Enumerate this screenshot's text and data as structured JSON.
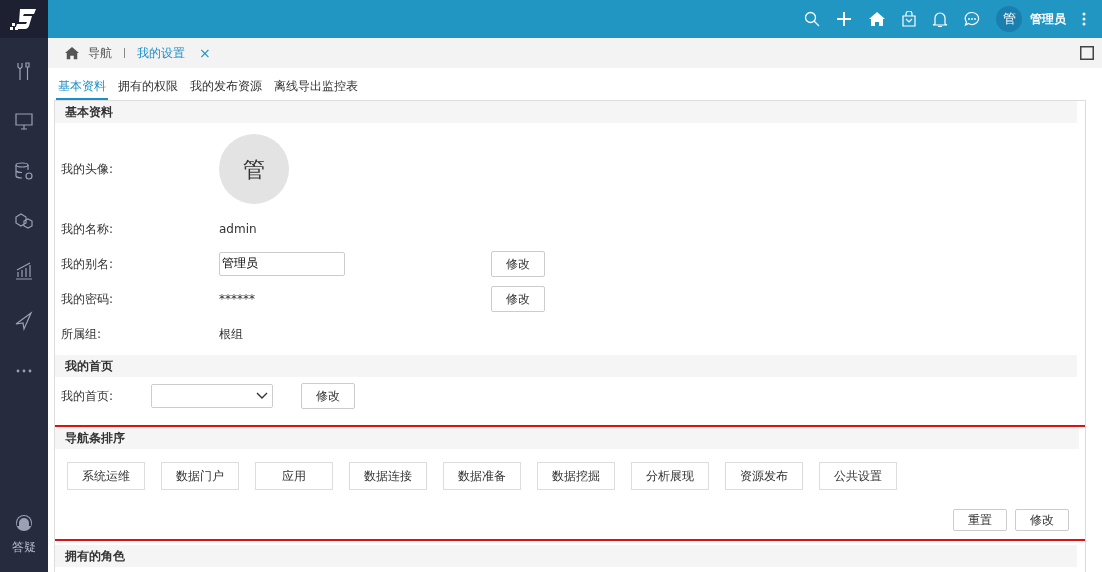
{
  "topbar": {
    "avatar_text": "管",
    "user_name": "管理员"
  },
  "sidebar": {
    "help_label": "答疑"
  },
  "breadcrumb": {
    "home": "导航",
    "current": "我的设置",
    "close": "×"
  },
  "tabs": [
    {
      "label": "基本资料",
      "selected": true
    },
    {
      "label": "拥有的权限",
      "selected": false
    },
    {
      "label": "我的发布资源",
      "selected": false
    },
    {
      "label": "离线导出监控表",
      "selected": false
    }
  ],
  "basic": {
    "title": "基本资料",
    "avatar_label": "我的头像:",
    "avatar_text": "管",
    "rows": [
      {
        "kind": "text",
        "label": "我的名称:",
        "value": "admin"
      },
      {
        "kind": "input",
        "label": "我的别名:",
        "value": "管理员",
        "button": "修改"
      },
      {
        "kind": "text",
        "label": "我的密码:",
        "value": "******",
        "button": "修改"
      },
      {
        "kind": "text",
        "label": "所属组:",
        "value": "根组"
      }
    ]
  },
  "homepage": {
    "title": "我的首页",
    "label": "我的首页:",
    "button": "修改"
  },
  "nav_order": {
    "title": "导航条排序",
    "highlighted": true,
    "items": [
      "系统运维",
      "数据门户",
      "应用",
      "数据连接",
      "数据准备",
      "数据挖掘",
      "分析展现",
      "资源发布",
      "公共设置"
    ],
    "buttons": [
      "重置",
      "修改"
    ]
  },
  "roles": {
    "title": "拥有的角色"
  }
}
